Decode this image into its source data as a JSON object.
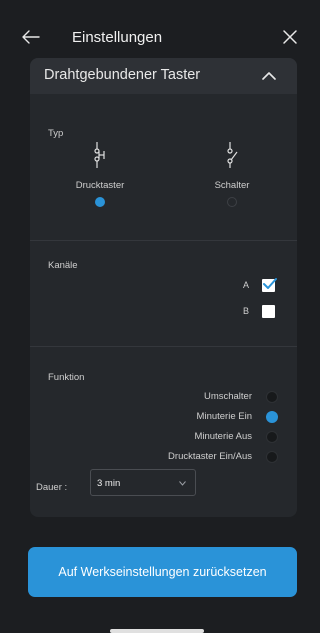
{
  "header": {
    "title": "Einstellungen",
    "back_icon": "arrow-left-icon",
    "close_icon": "close-icon"
  },
  "panel": {
    "title": "Drahtgebundener Taster",
    "collapse_icon": "chevron-up-icon",
    "type_section": {
      "label": "Typ",
      "options": [
        {
          "label": "Drucktaster",
          "icon": "push-button-symbol-icon",
          "selected": true
        },
        {
          "label": "Schalter",
          "icon": "switch-symbol-icon",
          "selected": false
        }
      ]
    },
    "channels_section": {
      "label": "Kanäle",
      "channels": [
        {
          "label": "A",
          "checked": true
        },
        {
          "label": "B",
          "checked": false
        }
      ]
    },
    "function_section": {
      "label": "Funktion",
      "options": [
        {
          "label": "Umschalter",
          "selected": false
        },
        {
          "label": "Minuterie Ein",
          "selected": true
        },
        {
          "label": "Minuterie Aus",
          "selected": false
        },
        {
          "label": "Drucktaster Ein/Aus",
          "selected": false
        }
      ],
      "duration_label": "Dauer :",
      "duration_value": "3 min"
    }
  },
  "reset_button": {
    "label": "Auf Werkseinstellungen zurücksetzen"
  },
  "colors": {
    "accent": "#2a93d8",
    "background": "#1c1e21",
    "panel": "#25282c"
  }
}
